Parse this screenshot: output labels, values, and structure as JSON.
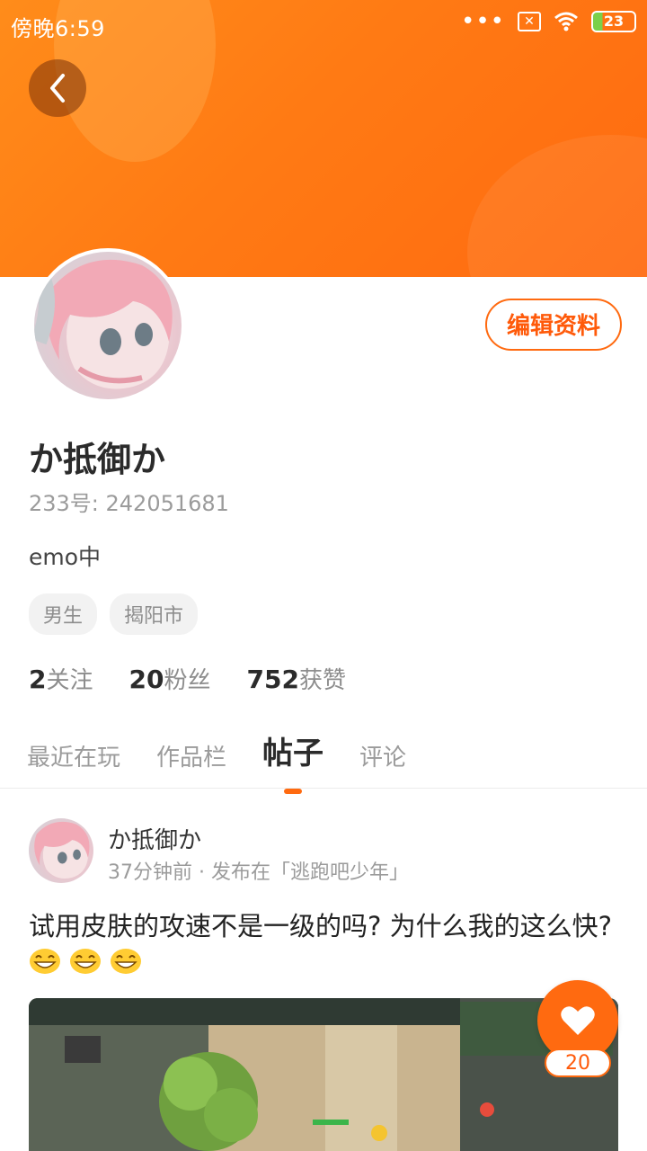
{
  "status_bar": {
    "time": "傍晚6:59",
    "dots": "•••",
    "battery": "23"
  },
  "profile": {
    "username": "か抵御か",
    "uid": "233号: 242051681",
    "bio": "emo中",
    "tags": [
      "男生",
      "揭阳市"
    ],
    "stats": [
      {
        "value": "2",
        "label": "关注"
      },
      {
        "value": "20",
        "label": "粉丝"
      },
      {
        "value": "752",
        "label": "获赞"
      }
    ],
    "edit_label": "编辑资料"
  },
  "tabs": [
    "最近在玩",
    "作品栏",
    "帖子",
    "评论"
  ],
  "active_tab": "帖子",
  "post": {
    "author": "か抵御か",
    "meta": "37分钟前 · 发布在「逃跑吧少年」",
    "text": "试用皮肤的攻速不是一级的吗? 为什么我的这么快?",
    "emoji_count": 3,
    "likes": "20"
  },
  "colors": {
    "accent": "#ff6a10",
    "banner_start": "#ff8c1a",
    "banner_end": "#ff6a10"
  }
}
